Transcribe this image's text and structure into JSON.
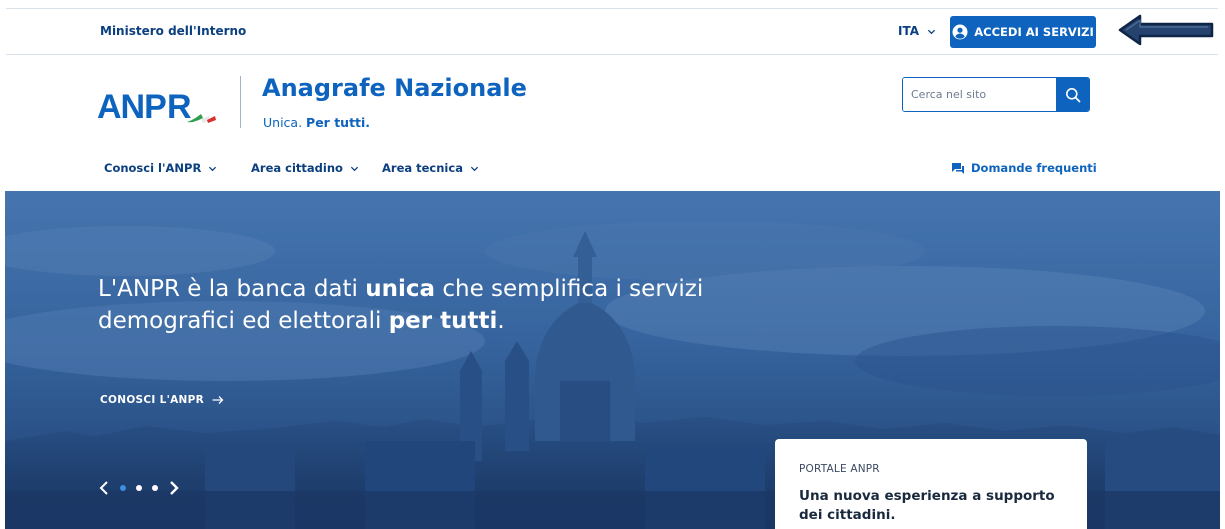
{
  "topbar": {
    "ministry": "Ministero dell'Interno",
    "language": "ITA",
    "login_label": "ACCEDI AI SERVIZI"
  },
  "header": {
    "logo_text": "ANPR",
    "title": "Anagrafe Nazionale",
    "subtitle_plain": "Unica.",
    "subtitle_bold": "Per tutti.",
    "search_placeholder": "Cerca nel sito"
  },
  "nav": {
    "items": [
      {
        "label": "Conosci l'ANPR"
      },
      {
        "label": "Area cittadino"
      },
      {
        "label": "Area tecnica"
      }
    ],
    "faq_label": "Domande frequenti"
  },
  "hero": {
    "text_1": "L'ANPR è la banca dati ",
    "text_bold_1": "unica",
    "text_2": " che semplifica i servizi demografici ed elettorali ",
    "text_bold_2": "per tutti",
    "text_3": ".",
    "link_label": "CONOSCI L'ANPR",
    "slide_count": 3,
    "active_slide": 1
  },
  "card": {
    "kicker": "PORTALE ANPR",
    "title": "Una nuova esperienza a supporto dei cittadini."
  },
  "colors": {
    "primary": "#0d63bd",
    "dark_blue": "#0b3f7f",
    "hero_overlay": "#1c4a86"
  },
  "icons": [
    "chevron-down-icon",
    "user-circle-icon",
    "search-icon",
    "chat-icon",
    "arrow-right-icon",
    "chevron-left-icon",
    "chevron-right-icon"
  ]
}
